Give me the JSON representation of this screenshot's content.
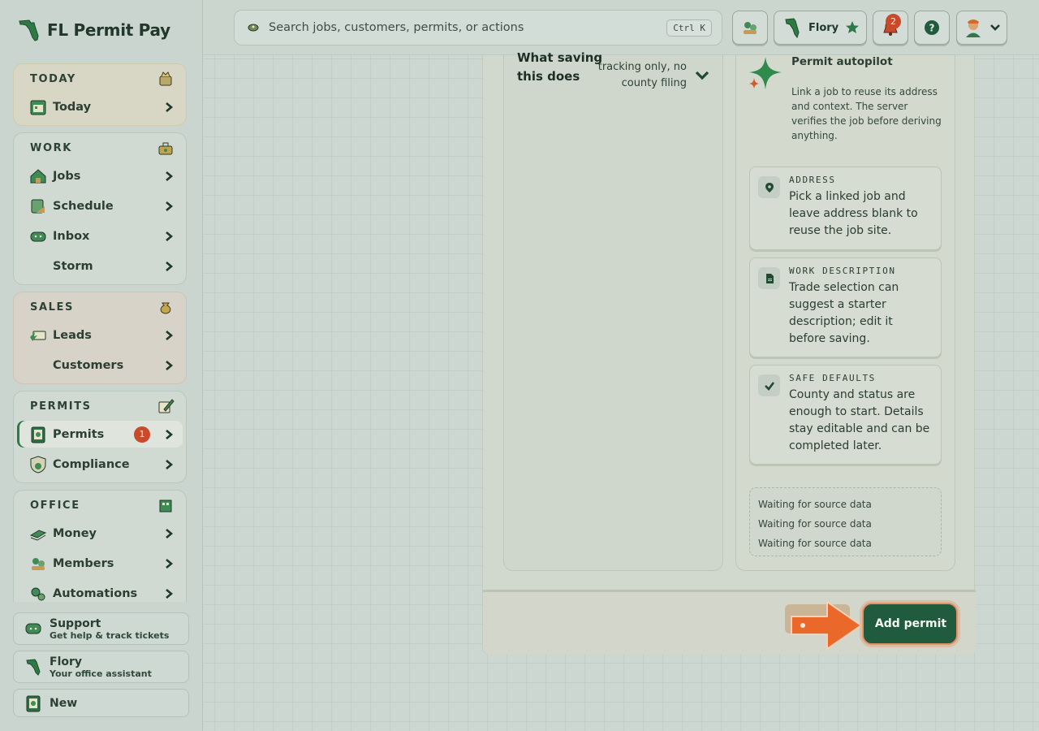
{
  "brand": {
    "name": "FL Permit Pay",
    "logo_icon": "florida-logo-icon"
  },
  "search": {
    "placeholder": "Search jobs, customers, permits, or actions",
    "shortcut": "Ctrl K"
  },
  "topbar": {
    "assistant_name": "Flory",
    "notifications_count": "2"
  },
  "nav": {
    "today": {
      "title": "TODAY",
      "items": [
        {
          "label": "Today"
        }
      ]
    },
    "work": {
      "title": "WORK",
      "items": [
        {
          "label": "Jobs"
        },
        {
          "label": "Schedule"
        },
        {
          "label": "Inbox"
        },
        {
          "label": "Storm"
        }
      ]
    },
    "sales": {
      "title": "SALES",
      "items": [
        {
          "label": "Leads"
        },
        {
          "label": "Customers"
        }
      ]
    },
    "permits": {
      "title": "PERMITS",
      "items": [
        {
          "label": "Permits",
          "badge": "1"
        },
        {
          "label": "Compliance"
        }
      ]
    },
    "office": {
      "title": "OFFICE",
      "items": [
        {
          "label": "Money"
        },
        {
          "label": "Members"
        },
        {
          "label": "Automations"
        }
      ]
    }
  },
  "side_buttons": {
    "support": {
      "title": "Support",
      "subtitle": "Get help & track tickets"
    },
    "flory": {
      "title": "Flory",
      "subtitle": "Your office assistant"
    },
    "new": {
      "title": "New"
    }
  },
  "saving": {
    "title": "What saving this does",
    "value": "tracking only, no county filing"
  },
  "autopilot": {
    "title": "Permit autopilot",
    "description": "Link a job to reuse its address and context. The server verifies the job before deriving anything.",
    "tips": [
      {
        "label": "ADDRESS",
        "text": "Pick a linked job and leave address blank to reuse the job site.",
        "icon": "map-pin-icon"
      },
      {
        "label": "WORK DESCRIPTION",
        "text": "Trade selection can suggest a starter description; edit it before saving.",
        "icon": "document-icon"
      },
      {
        "label": "SAFE DEFAULTS",
        "text": "County and status are enough to start. Details stay editable and can be completed later.",
        "icon": "check-icon"
      }
    ],
    "waiting": [
      "Waiting for source data",
      "Waiting for source data",
      "Waiting for source data"
    ]
  },
  "footer": {
    "primary_label": "Add permit"
  },
  "colors": {
    "accent": "#1f5b3c",
    "highlight": "#e36a2a",
    "badge": "#c94a2a"
  }
}
